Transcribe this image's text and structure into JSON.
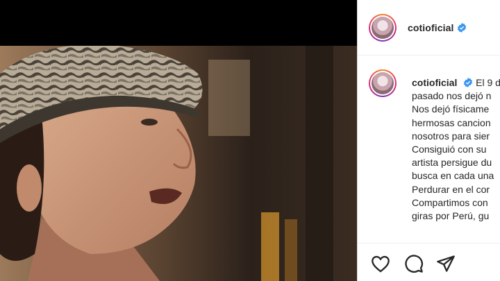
{
  "post": {
    "username": "cotioficial",
    "caption_lines": [
      "El 9 d",
      "pasado nos dejó n",
      "Nos dejó físicame",
      "hermosas cancion",
      "nosotros para sier",
      "Consiguió con su",
      "artista persigue du",
      "busca en cada una",
      "Perdurar en el cor",
      "Compartimos con",
      "giras por Perú, gu"
    ]
  },
  "icons": {
    "avatar": "profile-avatar",
    "verified": "verified-badge-icon",
    "like": "heart-icon",
    "comment": "comment-icon",
    "share": "share-icon"
  },
  "colors": {
    "verified_blue": "#3897f0",
    "text": "#262626",
    "ring_start": "#f58529",
    "ring_end": "#dd2a7b"
  }
}
